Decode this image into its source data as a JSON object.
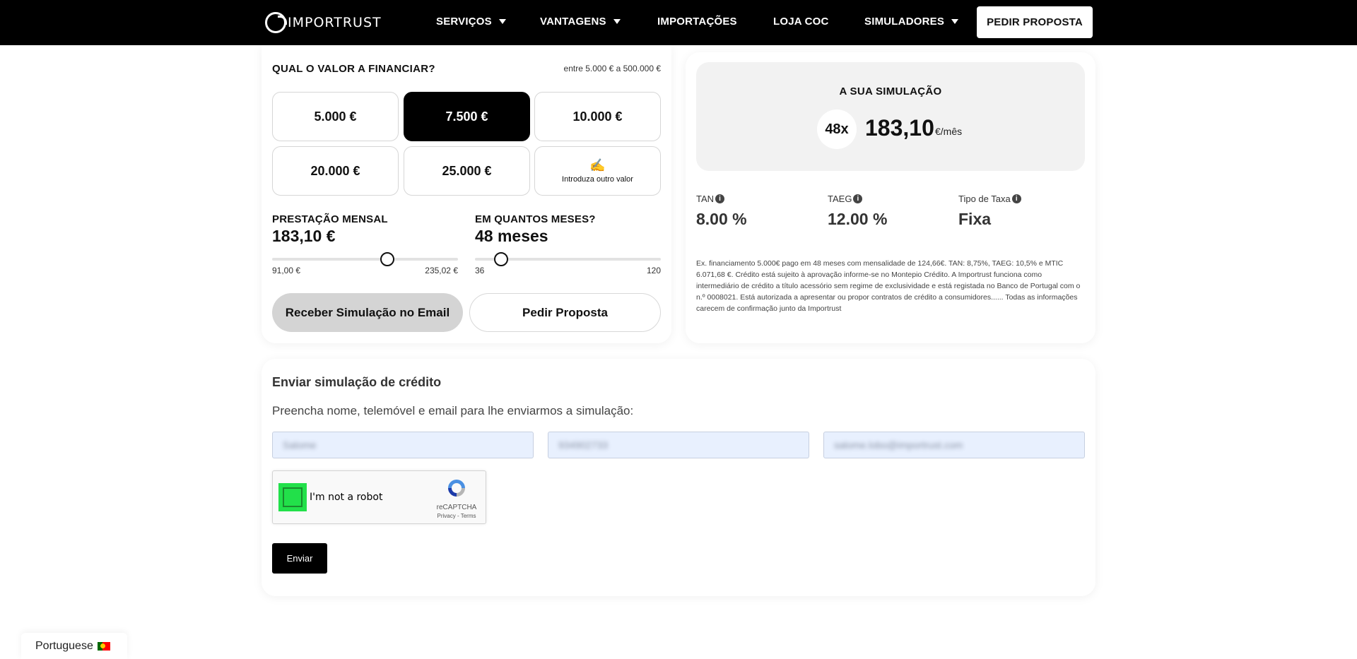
{
  "nav": {
    "brand": "IMPORTRUST",
    "items": [
      {
        "label": "SERVIÇOS",
        "has_caret": true
      },
      {
        "label": "VANTAGENS",
        "has_caret": true
      },
      {
        "label": "IMPORTAÇÕES",
        "has_caret": false
      },
      {
        "label": "LOJA COC",
        "has_caret": false
      },
      {
        "label": "SIMULADORES",
        "has_caret": true
      }
    ],
    "cta": "PEDIR PROPOSTA"
  },
  "financing": {
    "title": "QUAL O VALOR A FINANCIAR?",
    "range": "entre 5.000 € a 500.000 €",
    "amounts": [
      "5.000 €",
      "7.500 €",
      "10.000 €",
      "20.000 €",
      "25.000 €"
    ],
    "selected_amount": "7.500 €",
    "other_icon": "✍️",
    "other_label": "Introduza outro valor"
  },
  "monthly": {
    "label": "PRESTAÇÃO MENSAL",
    "value": "183,10 €",
    "min": "91,00 €",
    "max": "235,02 €",
    "slider_level": 0.62
  },
  "months": {
    "label": "EM QUANTOS MESES?",
    "value": "48 meses",
    "min": "36",
    "max": "120",
    "slider_level": 0.14
  },
  "actions": {
    "email": "Receber Simulação no Email",
    "proposal": "Pedir Proposta"
  },
  "simulation": {
    "title": "A SUA SIMULAÇÃO",
    "months": "48x",
    "amount": "183,10",
    "unit": "€/mês",
    "stats": [
      {
        "label": "TAN",
        "value": "8.00 %"
      },
      {
        "label": "TAEG",
        "value": "12.00 %"
      },
      {
        "label": "Tipo de Taxa",
        "value": "Fixa"
      }
    ],
    "disclaimer": "Ex. financiamento 5.000€ pago em 48 meses com mensalidade de 124,66€. TAN: 8,75%, TAEG: 10,5% e MTIC 6.071,68 €. Crédito está sujeito à aprovação informe-se no Montepio Crédito. A Importrust funciona como intermediário de crédito a título acessório sem regime de exclusividade e está registada no Banco de Portugal com o n.º 0008021. Está autorizada a apresentar ou propor contratos de crédito a consumidores...... Todas as informações carecem de confirmação junto da Importrust"
  },
  "send": {
    "title": "Enviar simulação de crédito",
    "subtitle": "Preencha nome, telemóvel e email para lhe enviarmos a simulação:",
    "fields": [
      "Salome",
      "934902733",
      "salome.lobo@importrust.com"
    ],
    "captcha_label": "I'm not a robot",
    "captcha_brand": "reCAPTCHA",
    "captcha_links": "Privacy - Terms",
    "submit": "Enviar"
  },
  "language": {
    "label": "Portuguese"
  },
  "colors": {
    "accent": "#000000",
    "captcha_check": "#22e04a",
    "field_bg": "#e8f0fe"
  }
}
